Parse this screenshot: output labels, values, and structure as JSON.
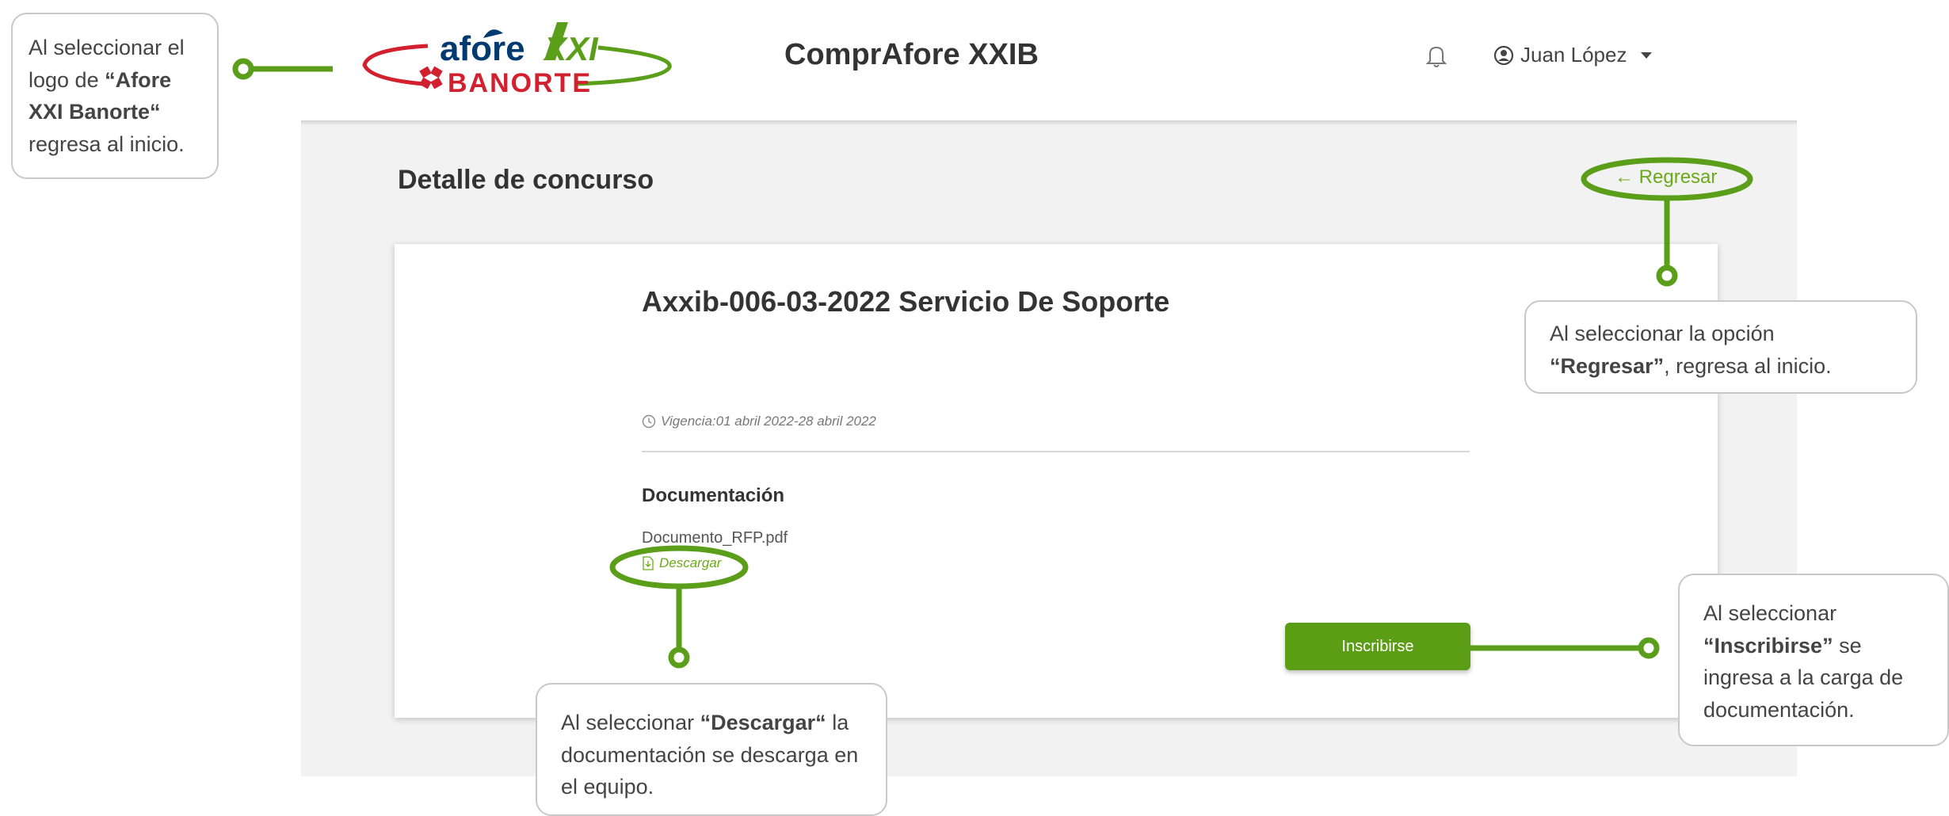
{
  "header": {
    "logo": {
      "top_text": "afore",
      "xxi_text": "XXI",
      "bottom_text": "BANORTE"
    },
    "app_title": "ComprAfore XXIB",
    "user_name": "Juan López",
    "icons": {
      "notifications": "bell-icon",
      "user": "user-circle-icon",
      "menu": "caret-down-icon"
    }
  },
  "page": {
    "title": "Detalle de concurso",
    "back_link": "← Regresar"
  },
  "contest": {
    "title": "Axxib-006-03-2022 Servicio De Soporte",
    "vigencia": "Vigencia:01 abril 2022-28 abril 2022",
    "documentation_heading": "Documentación",
    "file_name": "Documento_RFP.pdf",
    "download_label": "Descargar",
    "register_button": "Inscribirse"
  },
  "annotations": {
    "logo": {
      "pre": "Al seleccionar el logo de ",
      "bold": "“Afore XXI Banorte“",
      "post": " regresa al inicio."
    },
    "regresar": {
      "pre": "Al seleccionar la opción ",
      "bold": "“Regresar”",
      "post": ", regresa al inicio."
    },
    "inscribirse": {
      "pre": "Al seleccionar ",
      "bold": "“Inscribirse”",
      "post": " se ingresa a la carga de documentación."
    },
    "descargar": {
      "pre": "Al seleccionar ",
      "bold": "“Descargar“",
      "post": " la documentación se descarga en el equipo."
    }
  },
  "colors": {
    "accent_green": "#5b9e15",
    "link_green": "#6aaa1a",
    "annotation_green": "#5a9e1a",
    "banorte_red": "#d2202f",
    "panel_gray": "#f2f2f2"
  }
}
